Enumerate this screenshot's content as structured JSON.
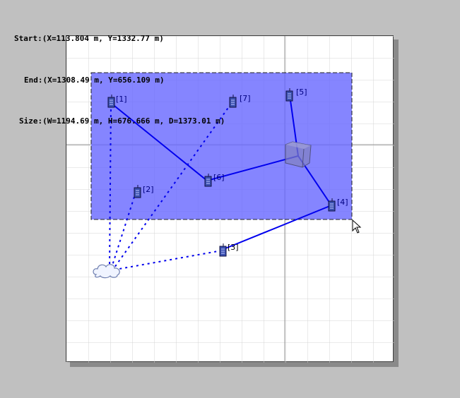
{
  "readout": {
    "start": "Start:(X=113.804 m, Y=1332.77 m)",
    "end": "End:(X=1308.49 m, Y=656.109 m)",
    "size": "Size:(W=1194.69 m, H=676.666 m, D=1373.01 m)"
  },
  "colors": {
    "background": "#c0c0c0",
    "selection_fill": "#6666ff",
    "link": "#0000ee",
    "grid": "#d4d4d4"
  },
  "nodes": [
    {
      "label": "[1]",
      "icon": "radio-node-icon"
    },
    {
      "label": "[2]",
      "icon": "radio-node-icon"
    },
    {
      "label": "[3]",
      "icon": "radio-node-icon"
    },
    {
      "label": "[4]",
      "icon": "radio-node-icon"
    },
    {
      "label": "[5]",
      "icon": "radio-node-icon"
    },
    {
      "label": "[6]",
      "icon": "radio-node-icon"
    },
    {
      "label": "[7]",
      "icon": "radio-node-icon"
    }
  ],
  "icons": {
    "cloud": "cloud-icon",
    "switch": "switch-cube-icon",
    "cursor": "mouse-cursor-icon"
  }
}
